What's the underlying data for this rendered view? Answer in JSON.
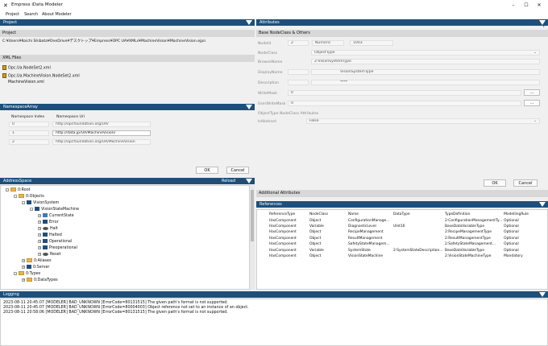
{
  "app": {
    "title": "Empress iData Modeler"
  },
  "menu": {
    "items": [
      "Project",
      "Search",
      "About Modeler"
    ]
  },
  "project_panel": {
    "header": "Project",
    "sub_header": "Project",
    "path": "C:¥Users¥Koichi Shibata¥OneDrive¥デスクトップ¥Empress¥OPC UA¥XMLs¥MachineVision¥MachineVision.ejpn",
    "xml_header": "XML Files",
    "xml_files": [
      "Opc.Ua.NodeSet2.xml",
      "Opc.Ua.MachineVision.NodeSet2.xml",
      "MachineVision.xml"
    ]
  },
  "namespace_panel": {
    "header": "NamespaceArray",
    "col_index": "Namespace Index",
    "col_uri": "Namespace Uri",
    "rows": [
      {
        "index": "0",
        "uri": "http://opcfoundation.org/UA/"
      },
      {
        "index": "1",
        "uri": "http://data.jp/UA/MachineVision/"
      },
      {
        "index": "2",
        "uri": "http://opcfoundation.org/UA/MachineVision"
      }
    ],
    "ok": "OK",
    "cancel": "Cancel"
  },
  "attributes_panel": {
    "header": "Attributes",
    "sub_header": "Base NodeClass & Others",
    "nodeid_label": "NodeId",
    "nodeid_ns": "2",
    "nodeid_type": "Numeric",
    "nodeid_value": "1003",
    "nodeclass_label": "NodeClass",
    "nodeclass_value": "ObjectType",
    "browsename_label": "BrowseName",
    "browsename_value": "2:VisionSystemType",
    "displayname_label": "DisplayName",
    "displayname_value": "VisionSystemType",
    "description_label": "Description",
    "description_value": "****",
    "writemask_label": "WriteMask",
    "writemask_value": "0",
    "userwritemask_label": "UserWriteMask",
    "userwritemask_value": "0",
    "ellipsis": "...",
    "objecttype_section": "ObjectType NodeClass Attributes",
    "isabstract_label": "IsAbstract",
    "isabstract_value": "False",
    "ok": "OK",
    "cancel": "Cancel"
  },
  "address_panel": {
    "header": "AddressSpace",
    "reload": "Reload",
    "tree": [
      {
        "label": "0:Root",
        "level": 0,
        "icon": "folder-icon",
        "exp": "-"
      },
      {
        "label": "0:Objects",
        "level": 1,
        "icon": "folder-icon",
        "exp": "-"
      },
      {
        "label": "VisionSystem",
        "level": 2,
        "icon": "object-icon",
        "exp": "-"
      },
      {
        "label": "VisionStateMachine",
        "level": 3,
        "icon": "object-icon",
        "exp": "-"
      },
      {
        "label": "CurrentState",
        "level": 4,
        "icon": "variable-icon",
        "exp": "+"
      },
      {
        "label": "Error",
        "level": 4,
        "icon": "object-icon",
        "exp": "+"
      },
      {
        "label": "Halt",
        "level": 4,
        "icon": "method-icon",
        "exp": "+"
      },
      {
        "label": "Halted",
        "level": 4,
        "icon": "object-icon",
        "exp": "+"
      },
      {
        "label": "Operational",
        "level": 4,
        "icon": "object-icon",
        "exp": "+"
      },
      {
        "label": "Preoperational",
        "level": 4,
        "icon": "object-icon",
        "exp": "+"
      },
      {
        "label": "Reset",
        "level": 4,
        "icon": "method-icon",
        "exp": "+"
      },
      {
        "label": "0:Aliases",
        "level": 2,
        "icon": "folder-icon",
        "exp": "+"
      },
      {
        "label": "0:Server",
        "level": 2,
        "icon": "object-icon",
        "exp": "+"
      },
      {
        "label": "0:Types",
        "level": 1,
        "icon": "folder-icon",
        "exp": "-"
      },
      {
        "label": "0:DataTypes",
        "level": 2,
        "icon": "folder-icon",
        "exp": "+"
      }
    ]
  },
  "additional": {
    "header": "Additional Attributes",
    "refs_header": "References",
    "columns": [
      "ReferenceType",
      "NodeClass",
      "Name",
      "DataType",
      "TypeDefinition",
      "ModellingRule"
    ],
    "rows": [
      [
        "HasComponent",
        "Object",
        "ConfigurationManage...",
        "",
        "2:ConfigurationManagementTy...",
        "Optional"
      ],
      [
        "HasComponent",
        "Variable",
        "DiagnosticLevel",
        "UInt16",
        "BaseDataVariableType",
        "Optional"
      ],
      [
        "HasComponent",
        "Object",
        "RecipeManagement",
        "",
        "2:RecipeManagementType",
        "Optional"
      ],
      [
        "HasComponent",
        "Object",
        "ResultManagement",
        "",
        "2:ResultManagementType",
        "Optional"
      ],
      [
        "HasComponent",
        "Object",
        "SafetyStateManagem...",
        "",
        "2:SafetyStateManagement...",
        "Optional"
      ],
      [
        "HasComponent",
        "Variable",
        "SystemState",
        "2:SystemStateDescription...",
        "BaseDataVariableType",
        "Optional"
      ],
      [
        "HasComponent",
        "Object",
        "VisionStateMachine",
        "",
        "2:VisionStateMachineType",
        "Mandatory"
      ]
    ]
  },
  "logging": {
    "header": "Logging",
    "lines": [
      "2023-08-11 20:45:07 [MODELER] BAD_UNKNOWN [ErrorCode=80131515] The given path's format is not supported.",
      "2023-08-11 20:45:07 [MODELER] BAD_UNKNOWN [ErrorCode=80004003] Object reference not set to an instance of an object.",
      "2023-08-11 20:58:06 [MODELER] BAD_UNKNOWN [ErrorCode=80131515] The given path's format is not supported."
    ]
  }
}
